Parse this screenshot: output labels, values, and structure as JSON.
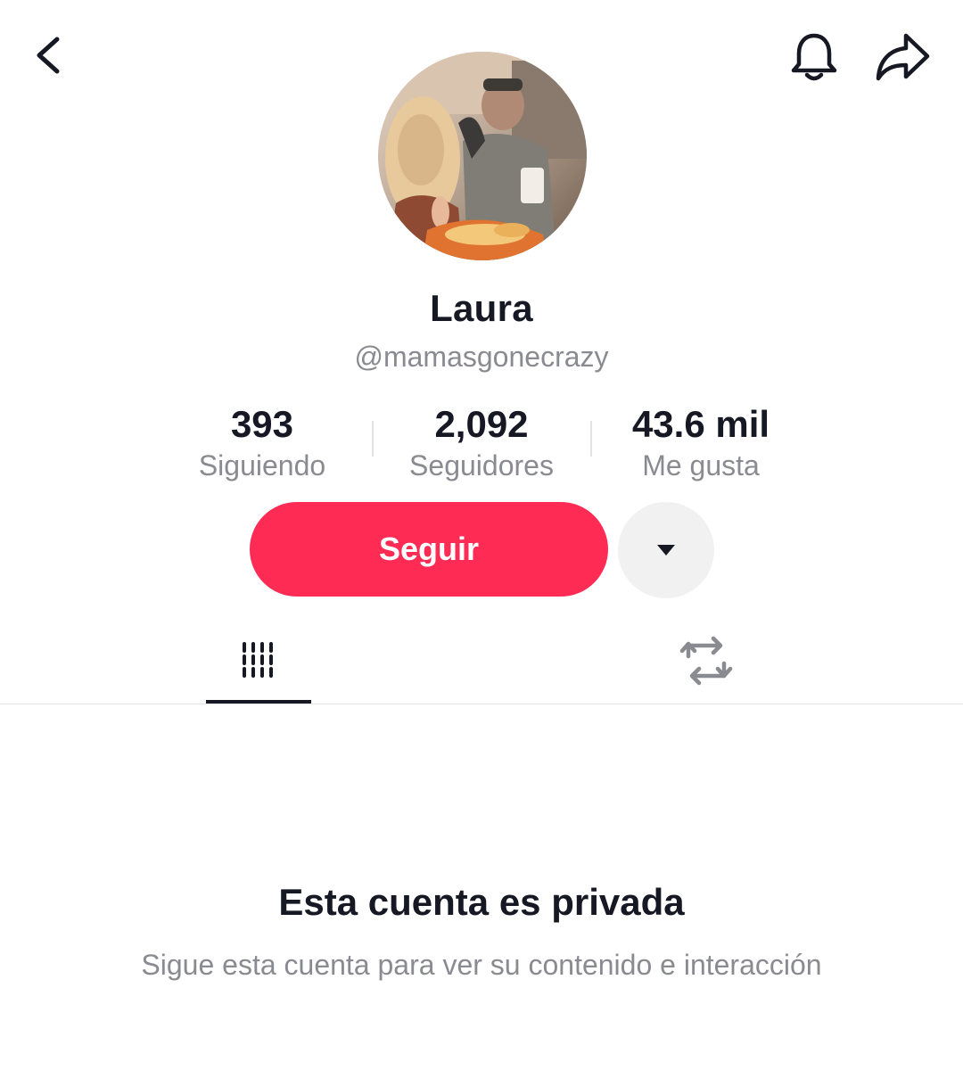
{
  "header": {
    "back_icon": "chevron-left-icon",
    "notification_icon": "bell-icon",
    "share_icon": "share-arrow-icon"
  },
  "profile": {
    "avatar_icon": "profile-photo",
    "display_name": "Laura",
    "username": "@mamasgonecrazy"
  },
  "stats": [
    {
      "value": "393",
      "label": "Siguiendo"
    },
    {
      "value": "2,092",
      "label": "Seguidores"
    },
    {
      "value": "43.6 mil",
      "label": "Me gusta"
    }
  ],
  "actions": {
    "follow_label": "Seguir",
    "follow_color": "#fe2c55",
    "more_icon": "caret-down-icon"
  },
  "tabs": [
    {
      "icon": "videos-grid-icon",
      "active": true
    },
    {
      "icon": "repost-icon",
      "active": false
    }
  ],
  "private_notice": {
    "title": "Esta cuenta es privada",
    "description": "Sigue esta cuenta para ver su contenido e interacción"
  }
}
